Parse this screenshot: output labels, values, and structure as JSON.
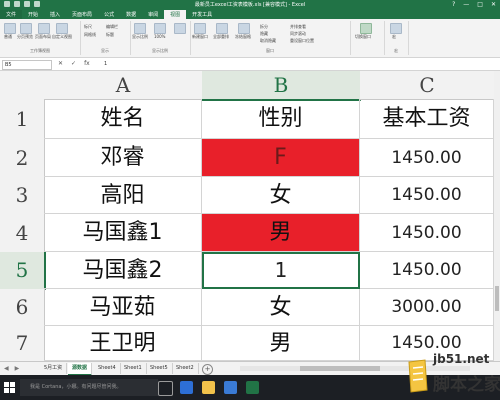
{
  "window": {
    "title": "最新员工excel工资表模板.xls [兼容模式] - Excel",
    "controls": [
      "?",
      "—",
      "□",
      "✕"
    ]
  },
  "ribbon_tabs": [
    {
      "label": "文件",
      "active": false
    },
    {
      "label": "开始",
      "active": false
    },
    {
      "label": "插入",
      "active": false
    },
    {
      "label": "页面布局",
      "active": false
    },
    {
      "label": "公式",
      "active": false
    },
    {
      "label": "数据",
      "active": false
    },
    {
      "label": "审阅",
      "active": false
    },
    {
      "label": "视图",
      "active": true
    },
    {
      "label": "开发工具",
      "active": false
    }
  ],
  "ribbon": {
    "groups": [
      "工作簿视图",
      "显示",
      "显示比例",
      "窗口",
      "宏"
    ],
    "buttons": [
      "普通",
      "分页预览",
      "页面布局",
      "自定义视图",
      "标尺",
      "编辑栏",
      "网格线",
      "标题",
      "显示比例",
      "100%",
      "缩放到选定区域",
      "新建窗口",
      "全部重排",
      "冻结窗格",
      "拆分",
      "隐藏",
      "取消隐藏",
      "并排查看",
      "同步滚动",
      "重设窗口位置",
      "切换窗口",
      "宏"
    ]
  },
  "formula_bar": {
    "name_box": "B5",
    "fx": "fx",
    "value": "1"
  },
  "columns": [
    "A",
    "B",
    "C"
  ],
  "rows": [
    {
      "num": "1",
      "cells": [
        "姓名",
        "性别",
        "基本工资"
      ]
    },
    {
      "num": "2",
      "cells": [
        "邓睿",
        "F",
        "1450.00"
      ]
    },
    {
      "num": "3",
      "cells": [
        "高阳",
        "女",
        "1450.00"
      ]
    },
    {
      "num": "4",
      "cells": [
        "马国鑫1",
        "男",
        "1450.00"
      ]
    },
    {
      "num": "5",
      "cells": [
        "马国鑫2",
        "1",
        "1450.00"
      ]
    },
    {
      "num": "6",
      "cells": [
        "马亚茹",
        "女",
        "3000.00"
      ]
    },
    {
      "num": "7",
      "cells": [
        "王卫明",
        "男",
        "1450.00"
      ]
    }
  ],
  "highlight_color": "#e8202a",
  "accent_color": "#217346",
  "sheet_tabs": [
    {
      "label": "5月工资",
      "active": false
    },
    {
      "label": "源数据",
      "active": true
    },
    {
      "label": "Sheet4",
      "active": false
    },
    {
      "label": "Sheet1",
      "active": false
    },
    {
      "label": "Sheet5",
      "active": false
    },
    {
      "label": "Sheet2",
      "active": false
    }
  ],
  "taskbar": {
    "search_placeholder": "我是 Cortana，小娜。有问题尽管问我。"
  },
  "watermark": {
    "site": "jb51.net",
    "name": "脚本之家"
  }
}
